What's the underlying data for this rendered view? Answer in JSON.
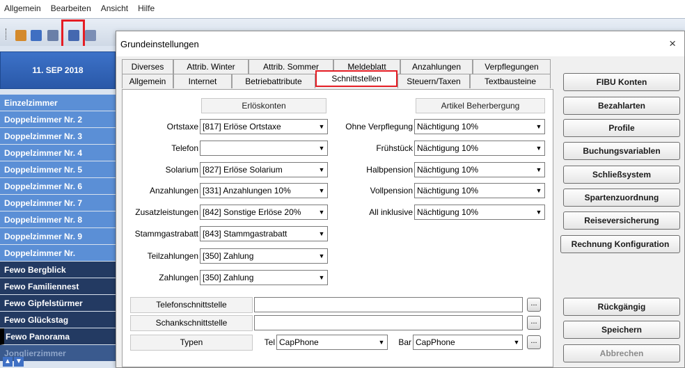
{
  "menubar": {
    "items": [
      "Allgemein",
      "Bearbeiten",
      "Ansicht",
      "Hilfe"
    ]
  },
  "toolbar": {
    "icons": [
      "users-icon",
      "users-icon",
      "interface-settings-icon",
      "save-icon",
      "connect-icon"
    ]
  },
  "sidebar": {
    "date": "11. SEP 2018",
    "rooms": [
      {
        "label": "Einzelzimmer",
        "style": "blue"
      },
      {
        "label": "Doppelzimmer Nr. 2",
        "style": "blue"
      },
      {
        "label": "Doppelzimmer Nr. 3",
        "style": "blue"
      },
      {
        "label": "Doppelzimmer Nr. 4",
        "style": "blue"
      },
      {
        "label": "Doppelzimmer Nr. 5",
        "style": "blue"
      },
      {
        "label": "Doppelzimmer Nr. 6",
        "style": "blue"
      },
      {
        "label": "Doppelzimmer Nr. 7",
        "style": "blue"
      },
      {
        "label": "Doppelzimmer Nr. 8",
        "style": "blue"
      },
      {
        "label": "Doppelzimmer Nr. 9",
        "style": "blue"
      },
      {
        "label": "Doppelzimmer Nr.",
        "style": "blue"
      },
      {
        "label": "Fewo Bergblick",
        "style": "dark"
      },
      {
        "label": "Fewo Familiennest",
        "style": "dark"
      },
      {
        "label": "Fewo Gipfelstürmer",
        "style": "dark"
      },
      {
        "label": "Fewo Glückstag",
        "style": "dark"
      },
      {
        "label": "Fewo Panorama",
        "style": "dark sel"
      },
      {
        "label": "Jonglierzimmer",
        "style": "disabled"
      }
    ]
  },
  "dialog": {
    "title": "Grundeinstellungen",
    "close": "×",
    "tabs_row1": [
      "Diverses",
      "Attrib. Winter",
      "Attrib. Sommer",
      "Meldeblatt",
      "Anzahlungen",
      "Verpflegungen"
    ],
    "tabs_row2": [
      "Allgemein",
      "Internet",
      "Betriebattribute",
      "Schnittstellen",
      "Steuern/Taxen",
      "Textbausteine"
    ],
    "active_tab": "Schnittstellen",
    "erloes_header": "Erlöskonten",
    "artikel_header": "Artikel Beherbergung",
    "erloes_rows": [
      {
        "label": "Ortstaxe",
        "value": "[817] Erlöse Ortstaxe"
      },
      {
        "label": "Telefon",
        "value": ""
      },
      {
        "label": "Solarium",
        "value": "[827] Erlöse Solarium"
      },
      {
        "label": "Anzahlungen",
        "value": "[331] Anzahlungen 10%"
      },
      {
        "label": "Zusatzleistungen",
        "value": "[842] Sonstige Erlöse 20%"
      },
      {
        "label": "Stammgastrabatt",
        "value": "[843] Stammgastrabatt"
      },
      {
        "label": "Teilzahlungen",
        "value": "[350] Zahlung"
      },
      {
        "label": "Zahlungen",
        "value": "[350] Zahlung"
      }
    ],
    "artikel_rows": [
      {
        "label": "Ohne Verpflegung",
        "value": "Nächtigung 10%"
      },
      {
        "label": "Frühstück",
        "value": "Nächtigung 10%"
      },
      {
        "label": "Halbpension",
        "value": "Nächtigung 10%"
      },
      {
        "label": "Vollpension",
        "value": "Nächtigung 10%"
      },
      {
        "label": "All inklusive",
        "value": "Nächtigung 10%"
      }
    ],
    "telefon_label": "Telefonschnittstelle",
    "telefon_value": "",
    "schank_label": "Schankschnittstelle",
    "schank_value": "",
    "typen_label": "Typen",
    "tel_label": "Tel",
    "tel_value": "CapPhone",
    "bar_label": "Bar",
    "bar_value": "CapPhone",
    "dots": "...",
    "buttons": [
      {
        "label": "FIBU Konten",
        "enabled": true
      },
      {
        "label": "Bezahlarten",
        "enabled": true
      },
      {
        "label": "Profile",
        "enabled": true
      },
      {
        "label": "Buchungsvariablen",
        "enabled": true
      },
      {
        "label": "Schließsystem",
        "enabled": true
      },
      {
        "label": "Spartenzuordnung",
        "enabled": true
      },
      {
        "label": "Reiseversicherung",
        "enabled": true
      },
      {
        "label": "Rechnung Konfiguration",
        "enabled": true
      }
    ],
    "action_buttons": [
      {
        "label": "Rückgängig",
        "enabled": true
      },
      {
        "label": "Speichern",
        "enabled": true
      },
      {
        "label": "Abbrechen",
        "enabled": false
      }
    ]
  },
  "colors": {
    "highlight": "#e51d24",
    "sidebar_blue": "#5b8fd6",
    "sidebar_dark": "#233a62",
    "datebox": "#2f62b5"
  }
}
